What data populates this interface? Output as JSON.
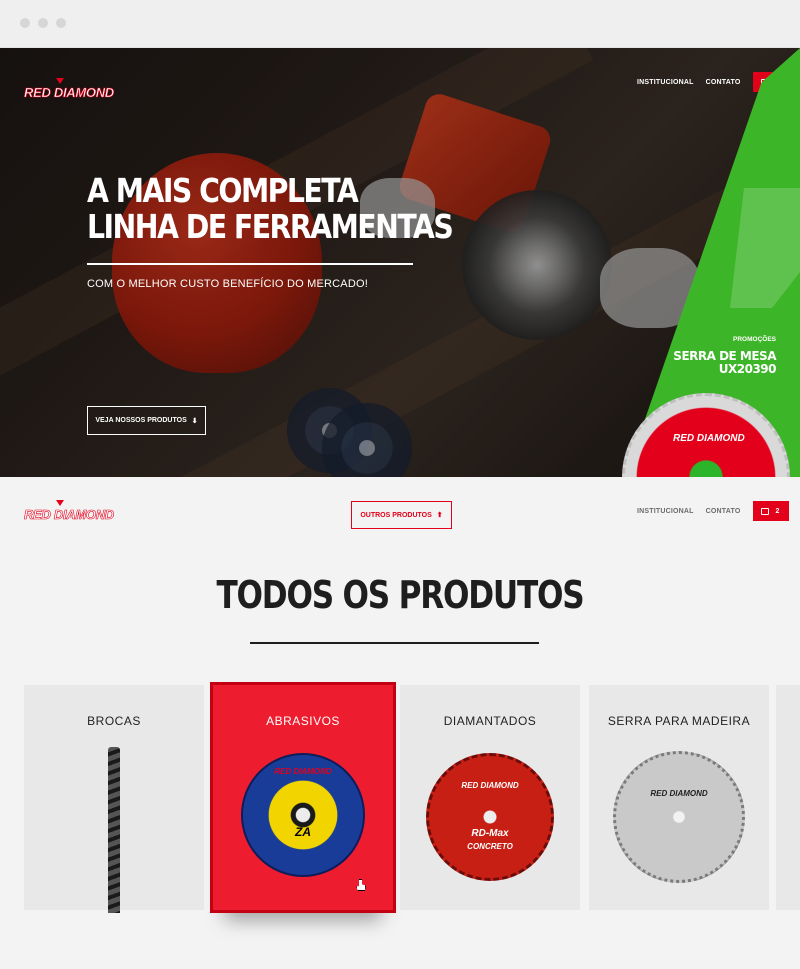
{
  "brand": {
    "logo_text": "RED DIAMOND"
  },
  "hero": {
    "nav": {
      "institucional": "INSTITUCIONAL",
      "contato": "CONTATO",
      "cart_count": "2"
    },
    "headline_line1": "A MAIS COMPLETA",
    "headline_line2": "LINHA DE FERRAMENTAS",
    "subtitle": "COM O MELHOR CUSTO BENEFÍCIO DO MERCADO!",
    "cta_label": "VEJA NOSSOS PRODUTOS",
    "cta_icon": "arrow-down-icon"
  },
  "promo": {
    "label": "PROMOÇÕES",
    "name_line1": "SERRA DE MESA",
    "name_line2": "UX20390",
    "disc_logo": "RED DIAMOND"
  },
  "subheader": {
    "outros_label": "OUTROS PRODUTOS",
    "outros_icon": "arrow-up-icon",
    "nav": {
      "institucional": "INSTITUCIONAL",
      "contato": "CONTATO",
      "cart_count": "2"
    }
  },
  "section": {
    "title": "TODOS OS PRODUTOS",
    "cards": [
      {
        "label": "BROCAS",
        "icon": "drill-bit-image"
      },
      {
        "label": "ABRASIVOS",
        "icon": "abrasive-disc-image",
        "disc_text": "RED DIAMOND",
        "disc_grade": "ZA"
      },
      {
        "label": "DIAMANTADOS",
        "icon": "diamond-blade-image",
        "disc_text": "RED DIAMOND",
        "disc_model": "RD-Max",
        "disc_type": "CONCRETO"
      },
      {
        "label": "SERRA PARA MADEIRA",
        "icon": "wood-saw-image",
        "disc_text": "RED DIAMOND"
      }
    ]
  },
  "colors": {
    "brand_red": "#e3001b",
    "promo_green": "#3db528",
    "page_bg": "#f3f3f3"
  }
}
